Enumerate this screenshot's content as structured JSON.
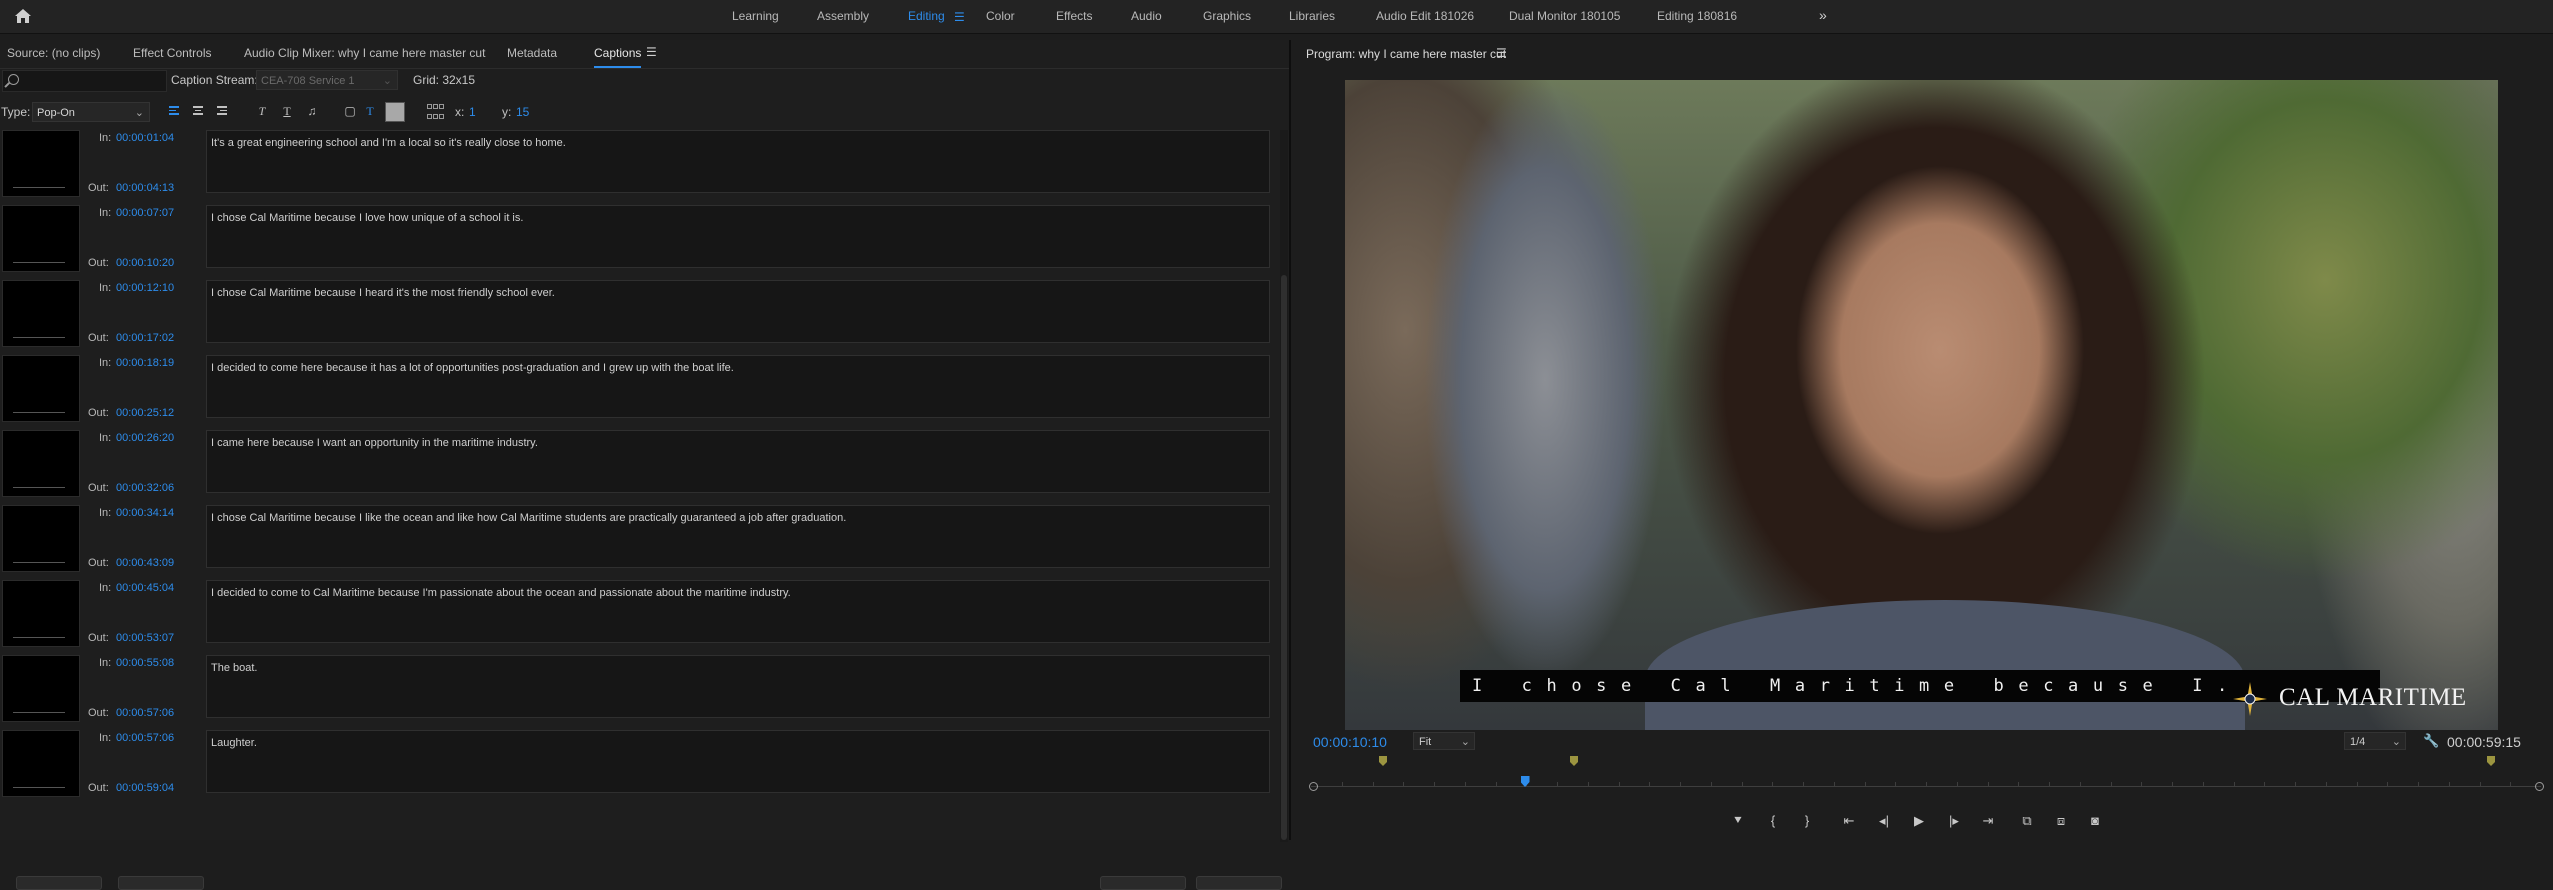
{
  "workspaces": {
    "items": [
      "Learning",
      "Assembly",
      "Editing",
      "Color",
      "Effects",
      "Audio",
      "Graphics",
      "Libraries",
      "Audio Edit 181026",
      "Dual Monitor 180105",
      "Editing 180816"
    ],
    "active": "Editing"
  },
  "left_panel": {
    "tabs": [
      "Source: (no clips)",
      "Effect Controls",
      "Audio Clip Mixer: why I came here master cut",
      "Metadata",
      "Captions"
    ],
    "active_tab": "Captions"
  },
  "captions_toolbar": {
    "search_placeholder": "",
    "caption_stream_label": "Caption Stream:",
    "caption_stream_value": "CEA-708 Service 1",
    "grid_label": "Grid: 32x15",
    "type_label": "Type:",
    "type_value": "Pop-On",
    "x_label": "x:",
    "x_value": "1",
    "y_label": "y:",
    "y_value": "15",
    "background_color": "#a8a8a8"
  },
  "captions": [
    {
      "in_label": "In:",
      "in": "00:00:01:04",
      "out_label": "Out:",
      "out": "00:00:04:13",
      "text": "It's a great engineering school and I'm a local so it's really close to home."
    },
    {
      "in_label": "In:",
      "in": "00:00:07:07",
      "out_label": "Out:",
      "out": "00:00:10:20",
      "text": "I chose Cal Maritime because I love how unique of a school it is."
    },
    {
      "in_label": "In:",
      "in": "00:00:12:10",
      "out_label": "Out:",
      "out": "00:00:17:02",
      "text": "I chose Cal Maritime because I heard it's the most friendly school ever."
    },
    {
      "in_label": "In:",
      "in": "00:00:18:19",
      "out_label": "Out:",
      "out": "00:00:25:12",
      "text": "I decided to come here because it has a lot of opportunities post-graduation and I grew up with the boat life."
    },
    {
      "in_label": "In:",
      "in": "00:00:26:20",
      "out_label": "Out:",
      "out": "00:00:32:06",
      "text": "I came here because I want an opportunity in the maritime industry."
    },
    {
      "in_label": "In:",
      "in": "00:00:34:14",
      "out_label": "Out:",
      "out": "00:00:43:09",
      "text": "I chose Cal Maritime because I like the ocean and like how Cal Maritime students are practically guaranteed a job after graduation."
    },
    {
      "in_label": "In:",
      "in": "00:00:45:04",
      "out_label": "Out:",
      "out": "00:00:53:07",
      "text": "I decided to come to Cal Maritime because I'm passionate about the ocean and passionate about the maritime industry."
    },
    {
      "in_label": "In:",
      "in": "00:00:55:08",
      "out_label": "Out:",
      "out": "00:00:57:06",
      "text": "The boat."
    },
    {
      "in_label": "In:",
      "in": "00:00:57:06",
      "out_label": "Out:",
      "out": "00:00:59:04",
      "text": "Laughter."
    }
  ],
  "program_monitor": {
    "title": "Program: why I came here master cut",
    "caption_overlay": "I chose Cal Maritime because I.",
    "logo_text": "CAL MARITIME",
    "current_timecode": "00:00:10:10",
    "fit": "Fit",
    "resolution": "1/4",
    "duration": "00:00:59:15",
    "playhead_fraction": 0.1736
  },
  "colors": {
    "accent": "#2d8ceb",
    "panel_bg": "#1e1e1e",
    "marker": "#9c9540"
  },
  "icons": {
    "home": "home-icon",
    "more": "chevron-double-right-icon",
    "search": "search-icon",
    "wrench": "wrench-icon"
  }
}
